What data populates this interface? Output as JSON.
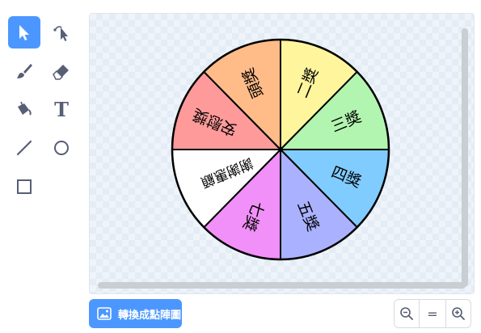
{
  "toolbar": {
    "tools": [
      {
        "icon": "select-arrow-icon",
        "active": true
      },
      {
        "icon": "reshape-icon",
        "active": false
      },
      {
        "icon": "brush-icon",
        "active": false
      },
      {
        "icon": "eraser-icon",
        "active": false
      },
      {
        "icon": "fill-bucket-icon",
        "active": false
      },
      {
        "icon": "text-tool-icon",
        "label": "T",
        "active": false
      },
      {
        "icon": "line-tool-icon",
        "active": false
      },
      {
        "icon": "circle-tool-icon",
        "active": false
      },
      {
        "icon": "rectangle-tool-icon",
        "active": false
      }
    ],
    "accent_color": "#4c97ff"
  },
  "wheel": {
    "segments": [
      {
        "label": "二獎",
        "color": "#fff59d"
      },
      {
        "label": "三獎",
        "color": "#b2f5b0"
      },
      {
        "label": "四獎",
        "color": "#80ccff"
      },
      {
        "label": "五獎",
        "color": "#aab2ff"
      },
      {
        "label": "七獎",
        "color": "#f090f8"
      },
      {
        "label": "謝謝惠顧",
        "color": "#ffffff"
      },
      {
        "label": "安慰獎",
        "color": "#ff9a9a"
      },
      {
        "label": "頭獎",
        "color": "#ffbb88"
      }
    ]
  },
  "footer": {
    "convert_label": "轉換成點陣圖",
    "zoom_out_icon": "zoom-out-icon",
    "zoom_reset_label": "=",
    "zoom_in_icon": "zoom-in-icon"
  }
}
